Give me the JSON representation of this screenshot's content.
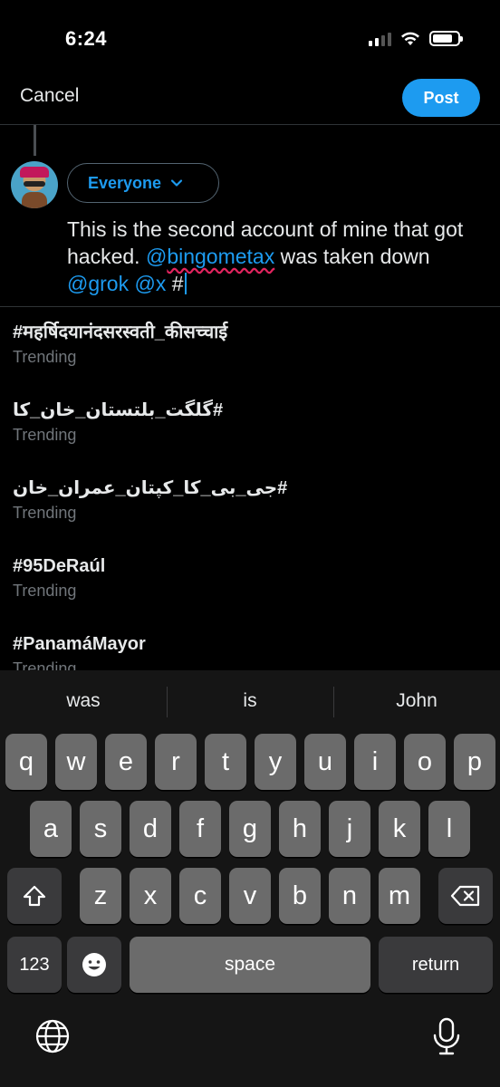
{
  "status_bar": {
    "time": "6:24",
    "battery_level": 0.8
  },
  "header": {
    "cancel_label": "Cancel",
    "post_label": "Post"
  },
  "composer": {
    "audience_label": "Everyone",
    "text_segments": [
      {
        "text": "This is the second account of mine that got hacked. ",
        "type": "plain"
      },
      {
        "text": "@",
        "type": "mention"
      },
      {
        "text": "bingometax",
        "type": "mention-spell"
      },
      {
        "text": " was taken down ",
        "type": "plain"
      },
      {
        "text": "@grok",
        "type": "mention"
      },
      {
        "text": " ",
        "type": "plain"
      },
      {
        "text": "@x",
        "type": "mention"
      },
      {
        "text": " #",
        "type": "plain"
      }
    ]
  },
  "trends": [
    {
      "name": "#महर्षिदयानंदसरस्वती_कीसच्चाई",
      "label": "Trending",
      "rtl": false
    },
    {
      "name": "#گلگت_بلتستان_خان_کا",
      "label": "Trending",
      "rtl": true
    },
    {
      "name": "#جی_بی_کا_کپتان_عمران_خان",
      "label": "Trending",
      "rtl": true
    },
    {
      "name": "#95DeRaúl",
      "label": "Trending",
      "rtl": false
    },
    {
      "name": "#PanamáMayor",
      "label": "Trending",
      "rtl": false
    }
  ],
  "keyboard": {
    "suggestions": [
      "was",
      "is",
      "John"
    ],
    "row1": [
      "q",
      "w",
      "e",
      "r",
      "t",
      "y",
      "u",
      "i",
      "o",
      "p"
    ],
    "row2": [
      "a",
      "s",
      "d",
      "f",
      "g",
      "h",
      "j",
      "k",
      "l"
    ],
    "row3": [
      "z",
      "x",
      "c",
      "v",
      "b",
      "n",
      "m"
    ],
    "numbers_label": "123",
    "space_label": "space",
    "return_label": "return"
  }
}
